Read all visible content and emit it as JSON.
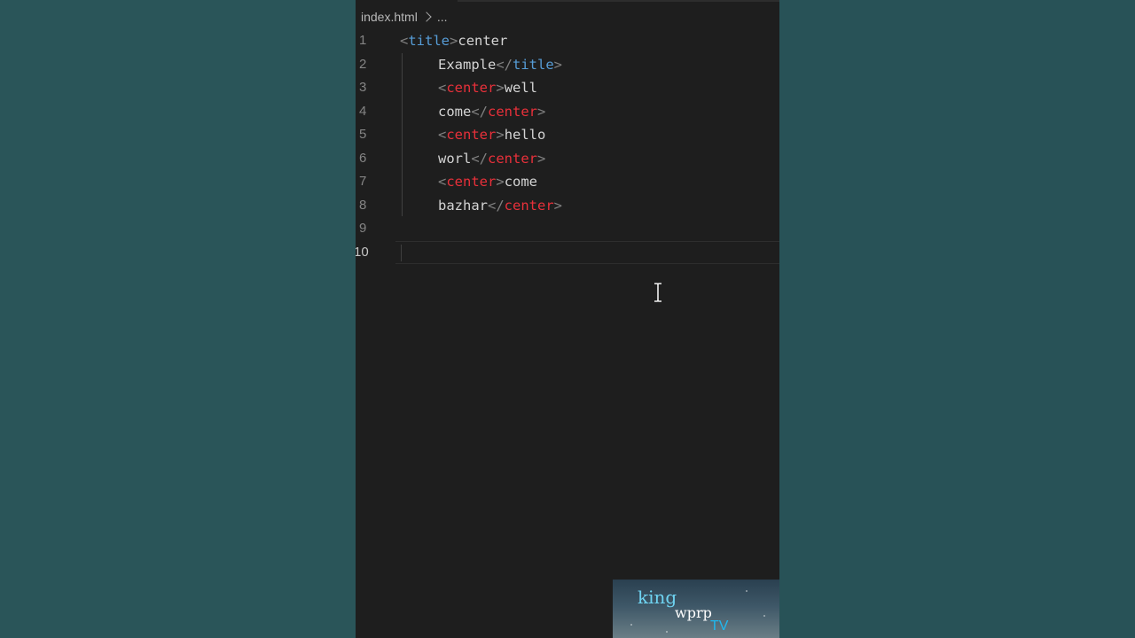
{
  "breadcrumb": {
    "file": "index.html",
    "ellipsis": "..."
  },
  "editor": {
    "lines": [
      {
        "number": "1",
        "tokens": [
          {
            "t": "<",
            "c": "bracket"
          },
          {
            "t": "title",
            "c": "tag-blue"
          },
          {
            "t": ">",
            "c": "bracket"
          },
          {
            "t": "center",
            "c": "text"
          }
        ]
      },
      {
        "number": "2",
        "tokens": [
          {
            "t": "Example",
            "c": "text"
          },
          {
            "t": "</",
            "c": "bracket"
          },
          {
            "t": "title",
            "c": "tag-blue"
          },
          {
            "t": ">",
            "c": "bracket"
          }
        ]
      },
      {
        "number": "3",
        "tokens": [
          {
            "t": "<",
            "c": "bracket"
          },
          {
            "t": "center",
            "c": "tag-red"
          },
          {
            "t": ">",
            "c": "bracket"
          },
          {
            "t": "well",
            "c": "text"
          }
        ]
      },
      {
        "number": "4",
        "tokens": [
          {
            "t": "come",
            "c": "text"
          },
          {
            "t": "</",
            "c": "bracket"
          },
          {
            "t": "center",
            "c": "tag-red"
          },
          {
            "t": ">",
            "c": "bracket"
          }
        ]
      },
      {
        "number": "5",
        "tokens": [
          {
            "t": "<",
            "c": "bracket"
          },
          {
            "t": "center",
            "c": "tag-red"
          },
          {
            "t": ">",
            "c": "bracket"
          },
          {
            "t": "hello",
            "c": "text"
          }
        ]
      },
      {
        "number": "6",
        "tokens": [
          {
            "t": "worl",
            "c": "text"
          },
          {
            "t": "</",
            "c": "bracket"
          },
          {
            "t": "center",
            "c": "tag-red"
          },
          {
            "t": ">",
            "c": "bracket"
          }
        ]
      },
      {
        "number": "7",
        "tokens": [
          {
            "t": "<",
            "c": "bracket"
          },
          {
            "t": "center",
            "c": "tag-red"
          },
          {
            "t": ">",
            "c": "bracket"
          },
          {
            "t": "come",
            "c": "text"
          }
        ]
      },
      {
        "number": "8",
        "tokens": [
          {
            "t": "bazhar",
            "c": "text"
          },
          {
            "t": "</",
            "c": "bracket"
          },
          {
            "t": "center",
            "c": "tag-red"
          },
          {
            "t": ">",
            "c": "bracket"
          }
        ]
      },
      {
        "number": "9",
        "tokens": []
      },
      {
        "number": "10",
        "tokens": []
      }
    ],
    "active_line": "10"
  },
  "watermark": {
    "word1": "king",
    "word2": "wprp",
    "word3": "TV"
  },
  "colors": {
    "tag_blue": "#569cd6",
    "tag_red": "#e8303a",
    "bracket": "#808080",
    "text": "#d4d4d4",
    "editor_bg": "#1e1e1e",
    "side_bg": "#2a5559"
  },
  "icons": {
    "breadcrumb_separator": "chevron-right-icon",
    "cursor": "text-cursor-icon"
  }
}
